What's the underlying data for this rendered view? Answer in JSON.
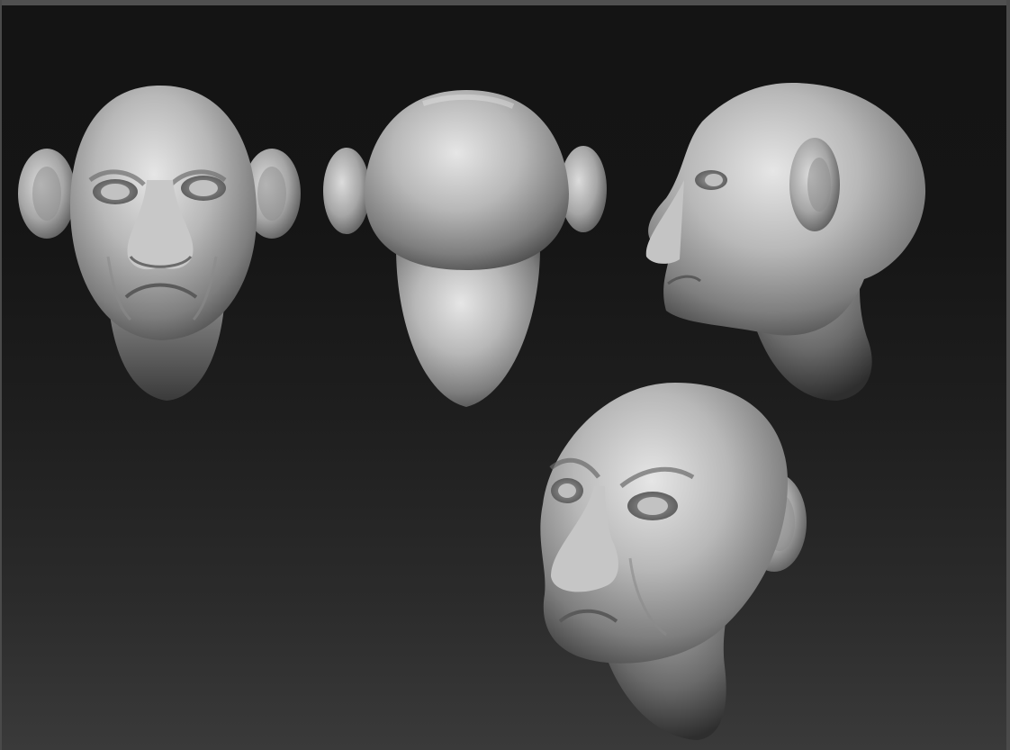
{
  "scene": {
    "views": [
      {
        "view": "front"
      },
      {
        "view": "back"
      },
      {
        "view": "side"
      },
      {
        "view": "three-quarter"
      }
    ],
    "colors": {
      "background_top": "#141414",
      "background_bottom": "#3a3a3a",
      "clay": "#b9b9b9",
      "clay_highlight": "#e4e4e4",
      "clay_shadow": "#4a4a4a"
    }
  }
}
